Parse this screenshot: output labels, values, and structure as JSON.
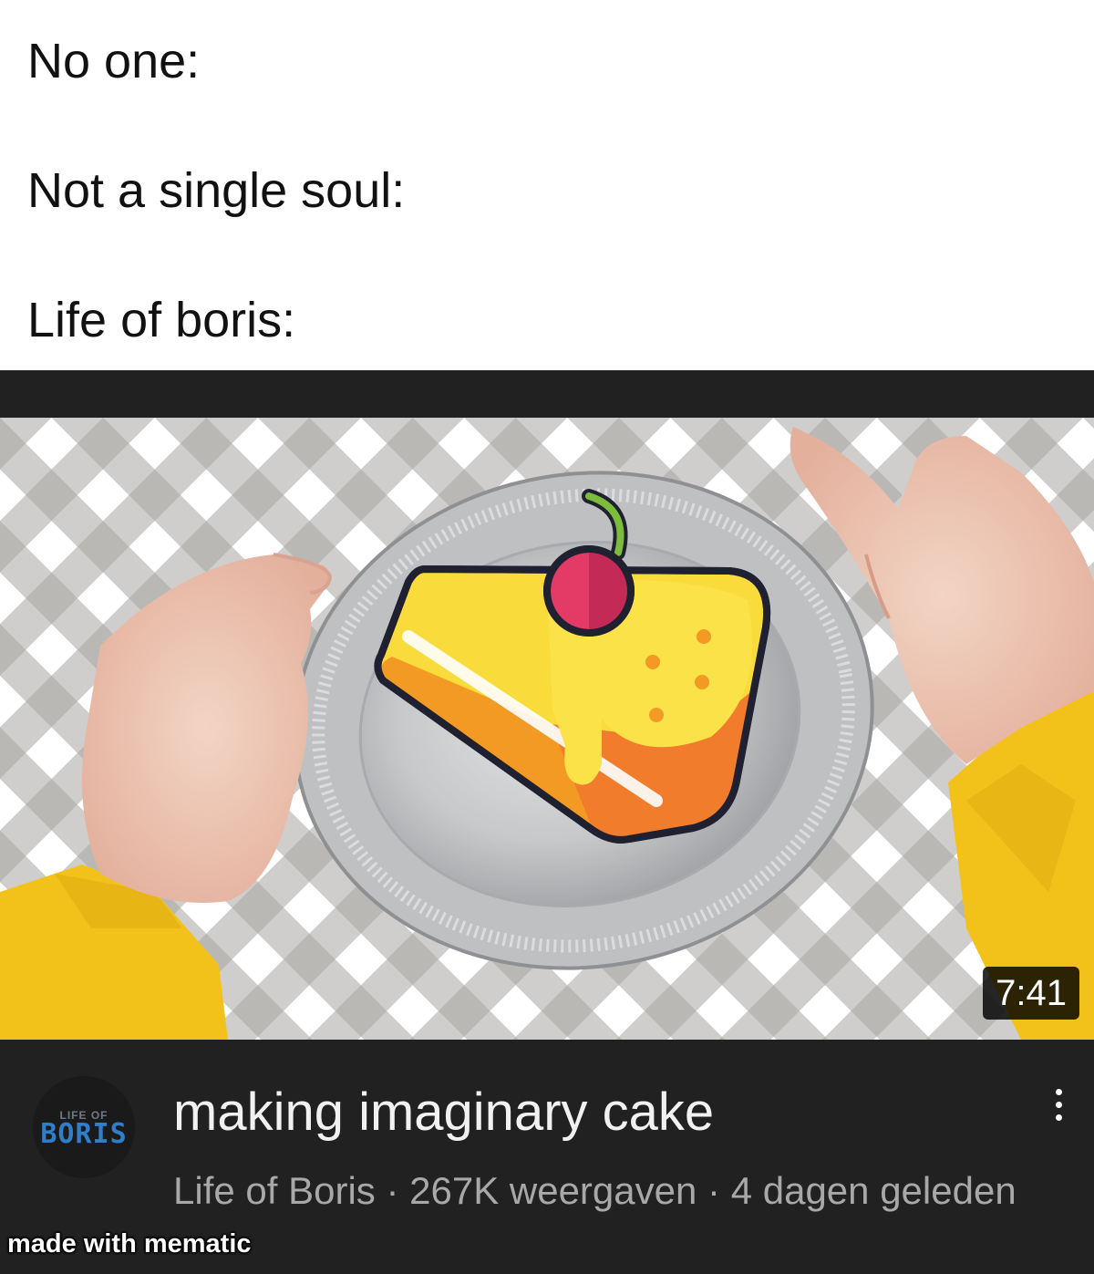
{
  "caption": {
    "line1": "No one:",
    "line2": "Not a single soul:",
    "line3": "Life of boris:"
  },
  "video": {
    "duration": "7:41",
    "title": "making imaginary cake",
    "channel": "Life of Boris",
    "separator": "·",
    "views": "267K weergaven",
    "age": "4 dagen geleden",
    "thumbnail_icons": [
      "cake-slice-icon",
      "cherry-icon",
      "pie-tin",
      "hand-left",
      "hand-right",
      "yellow-sleeves"
    ]
  },
  "avatar": {
    "small_text": "LIFE OF",
    "big_text": "BORIS",
    "color": "#2f7ec9"
  },
  "watermark": "made with mematic",
  "colors": {
    "player_bg": "#212121",
    "title": "#f1f1f1",
    "subtitle": "#a8a8a8",
    "sleeve_yellow": "#f2c21a",
    "cake_yellow": "#fadb3c",
    "cherry": "#e33a66"
  }
}
